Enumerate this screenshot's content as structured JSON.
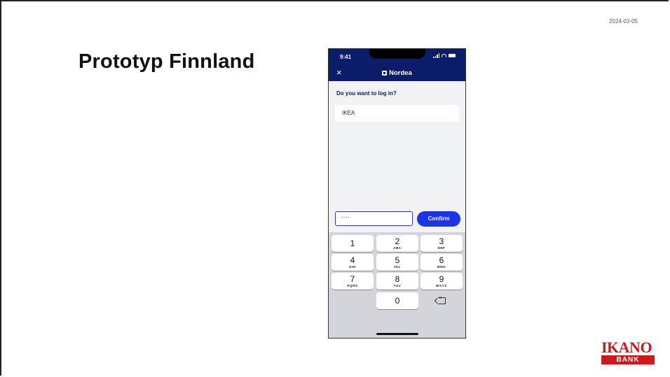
{
  "slide": {
    "date": "2024-03-05",
    "title": "Prototyp Finnland"
  },
  "phone": {
    "status_time": "9:41",
    "close_symbol": "×",
    "brand": "Nordea",
    "question": "Do you want to log in?",
    "merchant": "IKEA",
    "pin_placeholder": "••••",
    "confirm_label": "Confirm",
    "keypad": [
      {
        "digit": "1",
        "letters": ""
      },
      {
        "digit": "2",
        "letters": "ABC"
      },
      {
        "digit": "3",
        "letters": "DEF"
      },
      {
        "digit": "4",
        "letters": "GHI"
      },
      {
        "digit": "5",
        "letters": "JKL"
      },
      {
        "digit": "6",
        "letters": "MNO"
      },
      {
        "digit": "7",
        "letters": "PQRS"
      },
      {
        "digit": "8",
        "letters": "TUV"
      },
      {
        "digit": "9",
        "letters": "WXYZ"
      },
      {
        "digit": "0",
        "letters": ""
      }
    ],
    "colors": {
      "header": "#0a1c6a",
      "confirm": "#1a35e8"
    }
  },
  "logo": {
    "word": "IKANO",
    "sub": "BANK",
    "color": "#cc1a1a"
  }
}
